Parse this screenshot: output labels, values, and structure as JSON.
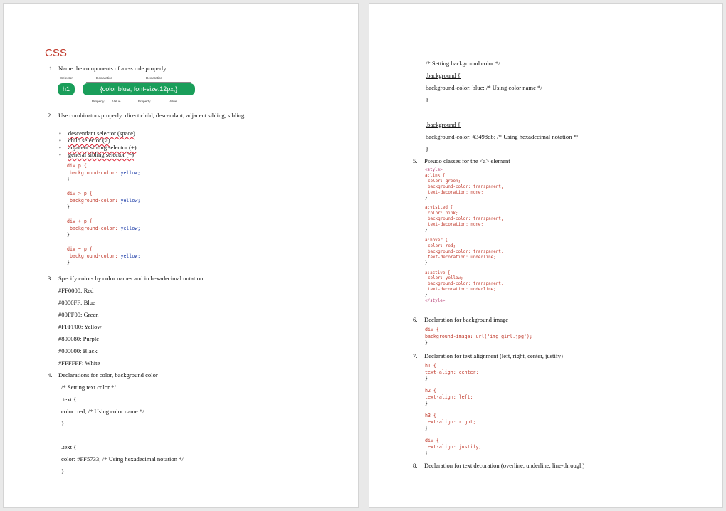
{
  "page1": {
    "title": "CSS",
    "q1": {
      "num": "1.",
      "text": "Name the components of a css rule properly"
    },
    "diagram": {
      "top_labels": [
        "Selector",
        "Declaration",
        "Declaration"
      ],
      "selector": "h1",
      "rule": "{color:blue; font-size:12px;}",
      "bottom_labels": [
        "Property",
        "Value",
        "Property",
        "Value"
      ]
    },
    "q2": {
      "num": "2.",
      "text": "Use combinators properly: direct child, descendant, adjacent sibling, sibling"
    },
    "bullets": [
      "descendant selector (space)",
      "child selector (>)",
      "adjacent sibling selector (+)",
      "general sibling selector (~)"
    ],
    "combinator_blocks": [
      {
        "sel": "div p {",
        "prop": "background-color:",
        "val": "yellow;",
        "close": "}"
      },
      {
        "sel": "div > p {",
        "prop": "background-color:",
        "val": "yellow;",
        "close": "}"
      },
      {
        "sel": "div + p {",
        "prop": "background-color:",
        "val": "yellow;",
        "close": "}"
      },
      {
        "sel": "div ~ p {",
        "prop": "background-color:",
        "val": "yellow;",
        "close": "}"
      }
    ],
    "q3": {
      "num": "3.",
      "text": "Specify colors by color names and in hexadecimal notation"
    },
    "colors": [
      "#FF0000: Red",
      "#0000FF: Blue",
      "#00FF00: Green",
      "#FFFF00: Yellow",
      "#800080: Purple",
      "#000000: Black",
      "#FFFFFF: White"
    ],
    "q4": {
      "num": "4.",
      "text": "Declarations for color, background color"
    },
    "q4_lines": [
      "/* Setting text color */",
      ".text {",
      " color: red; /* Using color name */",
      "}",
      ".text {",
      " color: #FF5733; /* Using hexadecimal notation */",
      "}"
    ]
  },
  "page2": {
    "top_lines": [
      "/* Setting background color */",
      ".background {",
      " background-color: blue; /* Using color name */",
      "}",
      ".background {",
      " background-color: #3498db; /* Using hexadecimal notation */",
      "}"
    ],
    "q5": {
      "num": "5.",
      "text": "Pseudo classes for the <a> element"
    },
    "pseudo_lines": [
      "<style>",
      "a:link {",
      "  color: green;",
      "  background-color: transparent;",
      "  text-decoration: none;",
      "}",
      "a:visited {",
      "  color: pink;",
      "  background-color: transparent;",
      "  text-decoration: none;",
      "}",
      "a:hover {",
      "  color: red;",
      "  background-color: transparent;",
      "  text-decoration: underline;",
      "}",
      "a:active {",
      "  color: yellow;",
      "  background-color: transparent;",
      "  text-decoration: underline;",
      "}",
      "</style>"
    ],
    "q6": {
      "num": "6.",
      "text": "Declaration for background image"
    },
    "q6_lines": [
      "div {",
      "  background-image: url('img_girl.jpg');",
      "}"
    ],
    "q7": {
      "num": "7.",
      "text": "Declaration for text alignment (left, right, center, justify)"
    },
    "q7_lines": [
      "h1 {",
      "  text-align: center;",
      "}",
      "h2 {",
      "  text-align: left;",
      "}",
      "h3 {",
      "  text-align: right;",
      "}",
      "div {",
      "  text-align: justify;",
      "}"
    ],
    "q8": {
      "num": "8.",
      "text": "Declaration for text decoration (overline, underline, line-through)"
    }
  }
}
